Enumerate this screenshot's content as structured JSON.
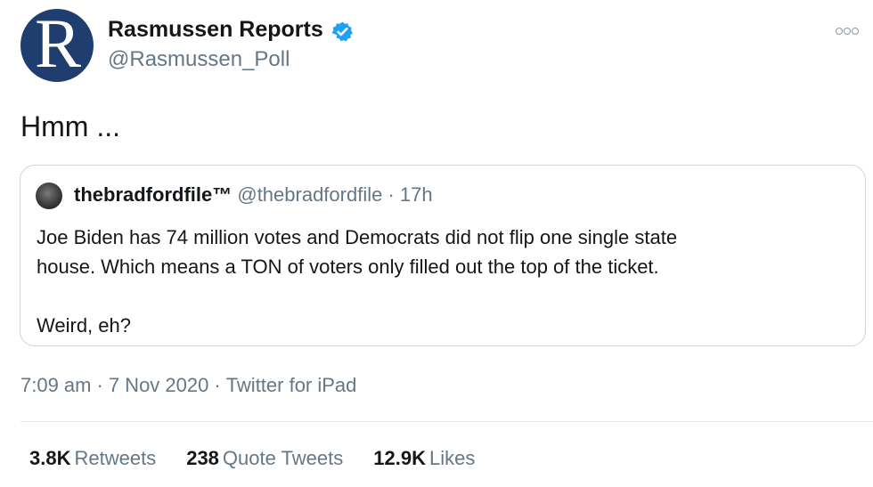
{
  "author": {
    "avatar_letter": "R",
    "name": "Rasmussen Reports",
    "handle": "@Rasmussen_Poll",
    "verified_icon": "verified-badge-icon"
  },
  "tweet": {
    "text": "Hmm ..."
  },
  "quoted_tweet": {
    "name": "thebradfordfile™",
    "handle": "@thebradfordfile",
    "separator": "·",
    "time": "17h",
    "line1": "Joe Biden has 74 million votes and Democrats did not flip one single state",
    "line2": "house. Which means a TON of voters only filled out the top of the ticket.",
    "line3": "Weird, eh?"
  },
  "meta": {
    "time": "7:09 am",
    "separator": "·",
    "date": "7 Nov 2020",
    "source": "Twitter for iPad"
  },
  "stats": {
    "retweets_count": "3.8K",
    "retweets_label": "Retweets",
    "quotes_count": "238",
    "quotes_label": "Quote Tweets",
    "likes_count": "12.9K",
    "likes_label": "Likes"
  },
  "colors": {
    "brand_blue": "#1da1f2",
    "secondary_text": "#657786",
    "avatar_navy": "#1f3d6e"
  }
}
